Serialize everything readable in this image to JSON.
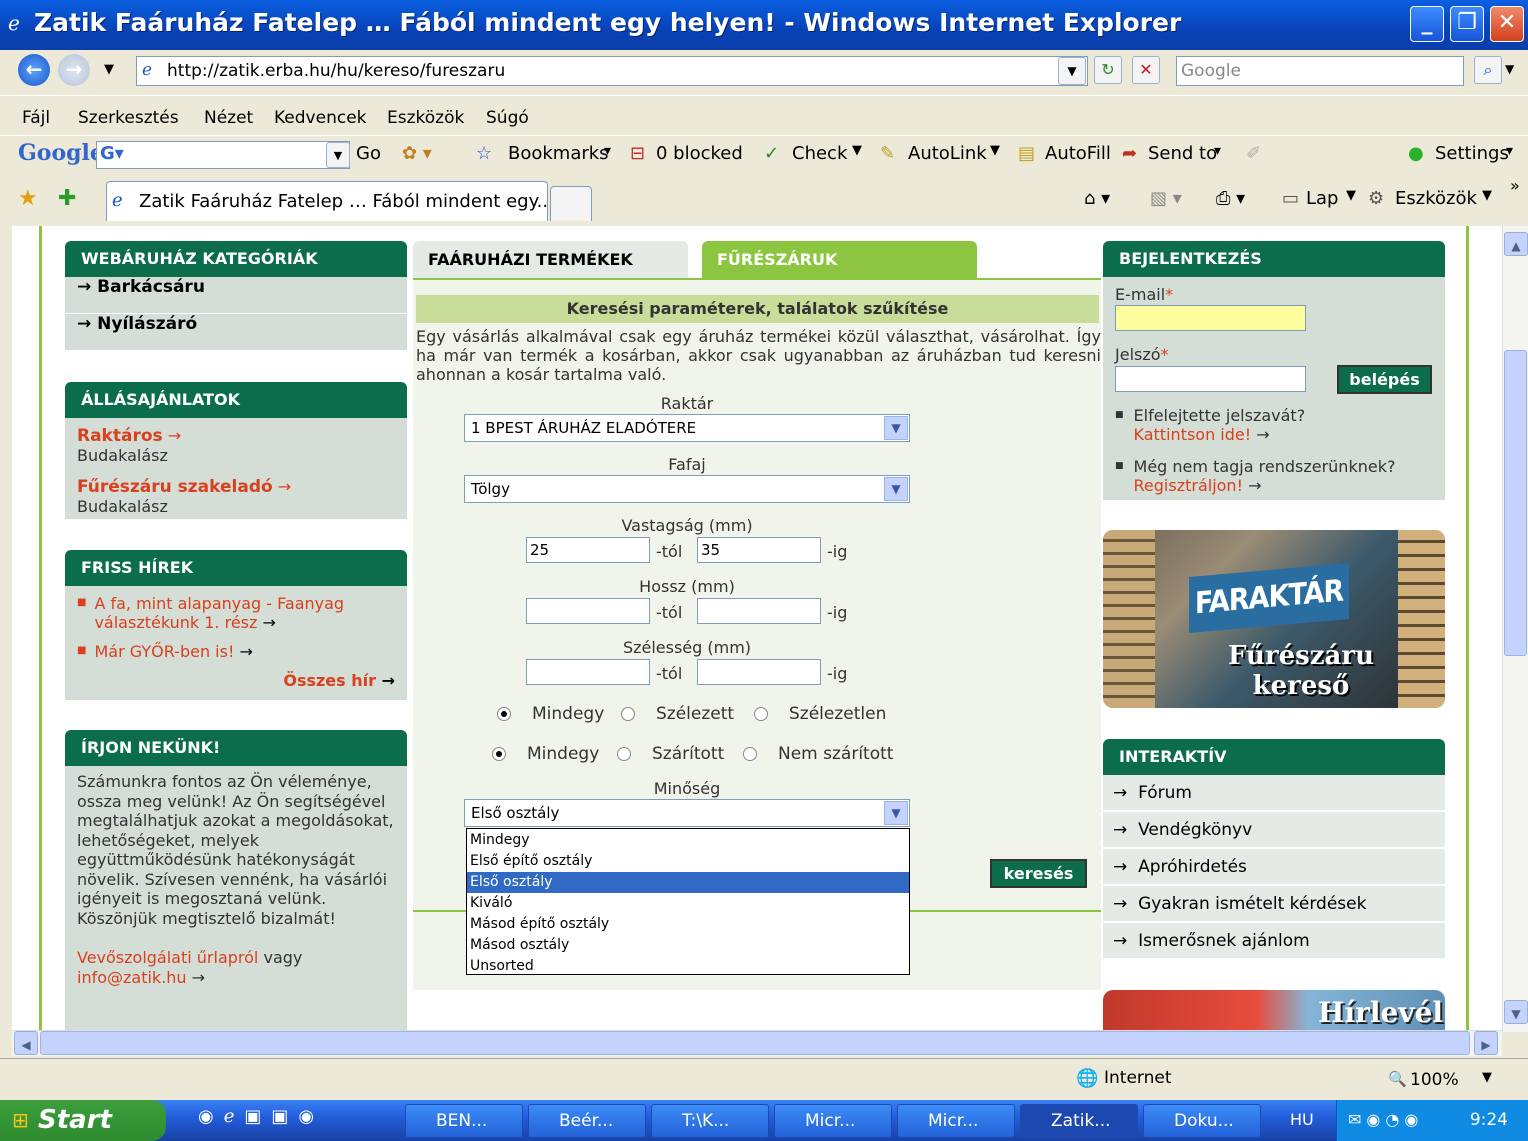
{
  "window": {
    "title": "Zatik Faáruház Fatelep … Fából mindent egy helyen! - Windows Internet Explorer",
    "min": "_",
    "max": "❐",
    "close": "✕"
  },
  "address": {
    "url": "http://zatik.erba.hu/hu/kereso/fureszaru",
    "search_placeholder": "Google"
  },
  "menu": [
    "Fájl",
    "Szerkesztés",
    "Nézet",
    "Kedvencek",
    "Eszközök",
    "Súgó"
  ],
  "gtoolbar": {
    "go": "Go",
    "bookmarks": "Bookmarks",
    "blocked": "0 blocked",
    "check": "Check",
    "autolink": "AutoLink",
    "autofill": "AutoFill",
    "sendto": "Send to",
    "settings": "Settings"
  },
  "tabs": {
    "active": "Zatik Faáruház Fatelep … Fából mindent egy..."
  },
  "tabtools": {
    "lap": "Lap",
    "eszkozok": "Eszközök"
  },
  "left": {
    "cat_title": "WEBÁRUHÁZ KATEGÓRIÁK",
    "categories": [
      "Barkácsáru",
      "Nyílászáró"
    ],
    "jobs_title": "ÁLLÁSAJÁNLATOK",
    "jobs": [
      {
        "title": "Raktáros",
        "loc": "Budakalász"
      },
      {
        "title": "Fűrészáru szakeladó",
        "loc": "Budakalász"
      }
    ],
    "news_title": "FRISS HÍREK",
    "news": [
      "A fa, mint alapanyag - Faanyag választékunk 1. rész",
      "Már GYŐR-ben is!"
    ],
    "news_all": "Összes hír",
    "write_title": "ÍRJON NEKÜNK!",
    "write_text": "Számunkra fontos az Ön véleménye, ossza meg velünk! Az Ön segítségével megtalálhatjuk azokat a megoldásokat, lehetőségeket, melyek együttműködésünk hatékonyságát növelik. Szívesen vennénk, ha vásárlói igényeit is megosztaná velünk. Köszönjük megtisztelő bizalmát!",
    "contact_link": "Vevőszolgálati űrlapról",
    "contact_or": "vagy",
    "contact_email": "info@zatik.hu"
  },
  "center": {
    "tab1": "FAÁRUHÁZI TERMÉKEK",
    "tab2": "FŰRÉSZÁRUK",
    "section_title": "Keresési paraméterek, találatok szűkítése",
    "intro": "Egy vásárlás alkalmával csak egy áruház termékei közül választhat, vásárolhat. Így ha már van termék a kosárban, akkor csak ugyanabban az áruházban tud keresni ahonnan a kosár tartalma való.",
    "raktar_label": "Raktár",
    "raktar_value": "1 BPEST ÁRUHÁZ ELADÓTERE",
    "fafaj_label": "Fafaj",
    "fafaj_value": "Tölgy",
    "vastag_label": "Vastagság (mm)",
    "vastag_from": "25",
    "vastag_to": "35",
    "hossz_label": "Hossz (mm)",
    "szeles_label": "Szélesség (mm)",
    "tol": "-tól",
    "ig": "-ig",
    "radio1": [
      "Mindegy",
      "Szélezett",
      "Szélezetlen"
    ],
    "radio2": [
      "Mindegy",
      "Szárított",
      "Nem szárított"
    ],
    "minoseg_label": "Minőség",
    "minoseg_value": "Első osztály",
    "minoseg_options": [
      "Mindegy",
      "Első építő osztály",
      "Első osztály",
      "Kiváló",
      "Másod építő osztály",
      "Másod osztály",
      "Unsorted"
    ],
    "search_btn": "keresés"
  },
  "right": {
    "login_title": "BEJELENTKEZÉS",
    "email_label": "E-mail",
    "password_label": "Jelszó",
    "login_btn": "belépés",
    "forgot": "Elfelejtette jelszavát?",
    "forgot_link": "Kattintson ide!",
    "notmember": "Még nem tagja rendszerünknek?",
    "register_link": "Regisztráljon!",
    "banner1": "FARAKTÁR",
    "banner2": "Fűrészáru",
    "banner3": "kereső",
    "inter_title": "INTERAKTÍV",
    "inter_items": [
      "Fórum",
      "Vendégkönyv",
      "Apróhirdetés",
      "Gyakran ismételt kérdések",
      "Ismerősnek ajánlom"
    ],
    "newsletter": "Hírlevél"
  },
  "status": {
    "zone": "Internet",
    "zoom": "100%"
  },
  "taskbar": {
    "start": "Start",
    "tasks": [
      "BEN...",
      "Beér...",
      "T:\\K...",
      "Micr...",
      "Micr...",
      "Zatik...",
      "Doku..."
    ],
    "lang": "HU",
    "time": "9:24"
  }
}
